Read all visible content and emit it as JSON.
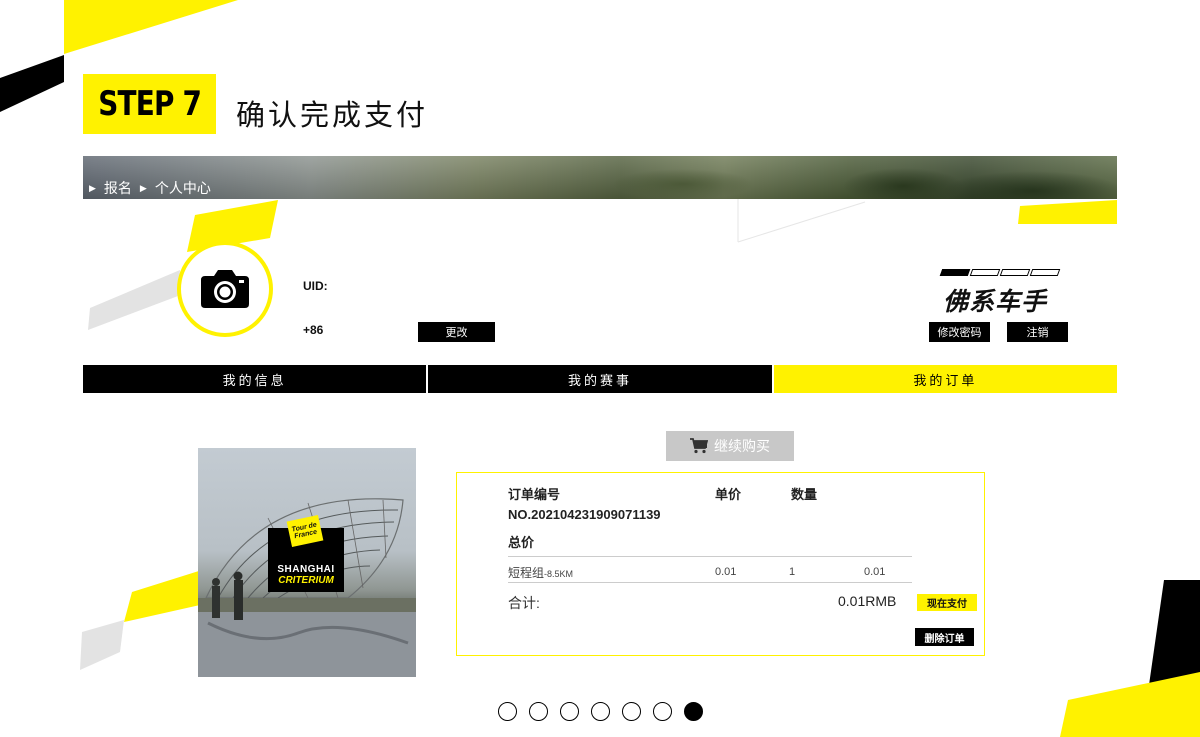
{
  "step": {
    "badge": "STEP 7",
    "title": "确认完成支付"
  },
  "breadcrumb": {
    "items": [
      "报名",
      "个人中心"
    ]
  },
  "profile": {
    "uid_label": "UID:",
    "phone_prefix": "+86",
    "edit_button": "更改",
    "avatar_icon": "camera-icon",
    "level": {
      "name": "佛系车手",
      "segments_total": 4,
      "segments_filled": 1
    },
    "change_password_button": "修改密码",
    "logout_button": "注销"
  },
  "tabs": [
    {
      "label": "我的信息",
      "active": false
    },
    {
      "label": "我的赛事",
      "active": false
    },
    {
      "label": "我的订单",
      "active": true
    }
  ],
  "product_image": {
    "sign_logo": "Tour de France",
    "sign_line1": "SHANGHAI",
    "sign_line2": "CRITERIUM"
  },
  "continue_button": {
    "label": "继续购买",
    "icon": "cart-icon"
  },
  "order": {
    "number_label": "订单编号",
    "number": "NO.202104231909071139",
    "unit_price_label": "单价",
    "quantity_label": "数量",
    "total_price_label": "总价",
    "item": {
      "name": "短程组",
      "distance": "-8.5KM",
      "unit_price": "0.01",
      "quantity": "1",
      "total": "0.01"
    },
    "sum_label": "合计:",
    "sum_value": "0.01RMB",
    "pay_button": "现在支付",
    "delete_button": "删除订单"
  },
  "pager": {
    "total": 7,
    "current": 7
  },
  "colors": {
    "accent": "#fff200",
    "dark": "#000000",
    "muted": "#c8c8c8"
  }
}
